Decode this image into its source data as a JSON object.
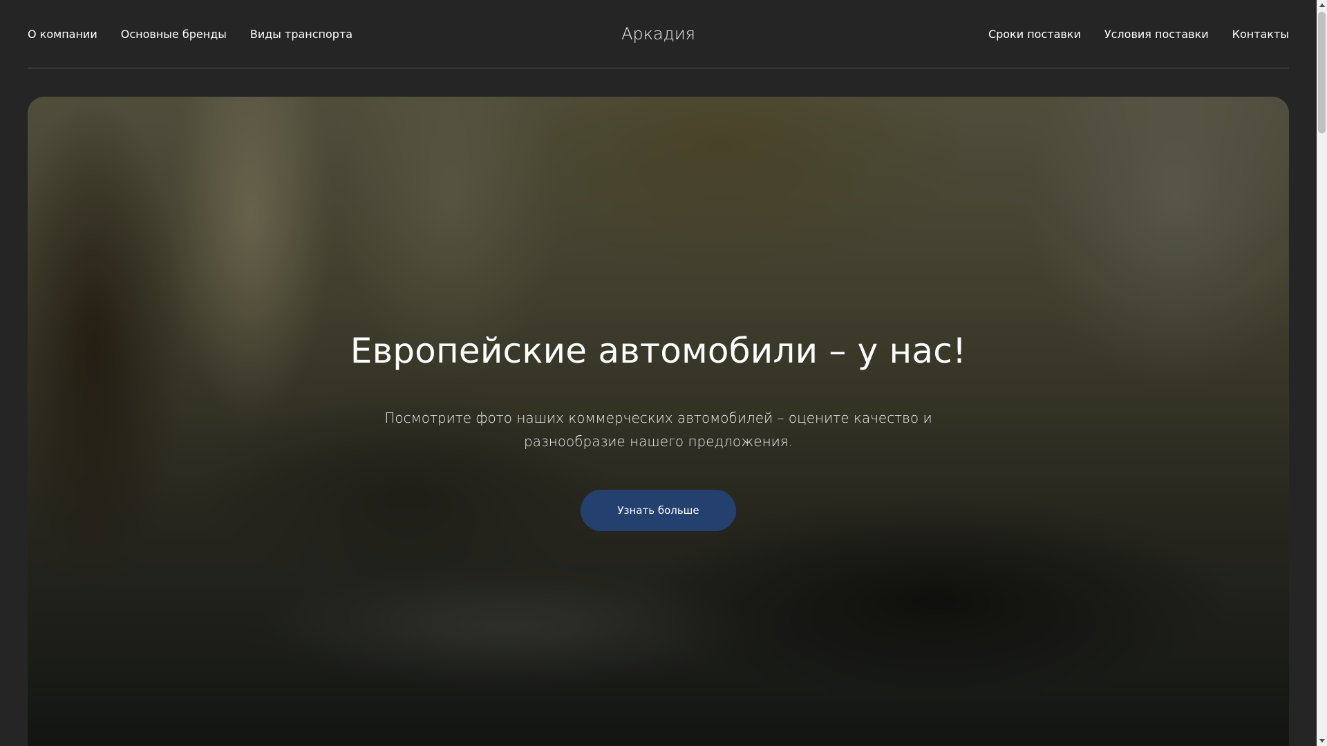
{
  "header": {
    "nav_left": [
      {
        "label": "О компании"
      },
      {
        "label": "Основные бренды"
      },
      {
        "label": "Виды транспорта"
      }
    ],
    "brand": "Аркадия",
    "nav_right": [
      {
        "label": "Сроки поставки"
      },
      {
        "label": "Условия поставки"
      },
      {
        "label": "Контакты"
      }
    ]
  },
  "hero": {
    "title": "Европейские автомобили – у нас!",
    "subtitle": "Посмотрите фото наших коммерческих автомобилей – оцените качество и разнообразие нашего предложения.",
    "button_label": "Узнать больше"
  },
  "colors": {
    "page_background": "#252525",
    "button_background": "#24406f",
    "text": "#ffffff"
  },
  "icons": {
    "scroll_up": "triangle-up-icon",
    "scroll_down": "triangle-down-icon"
  }
}
